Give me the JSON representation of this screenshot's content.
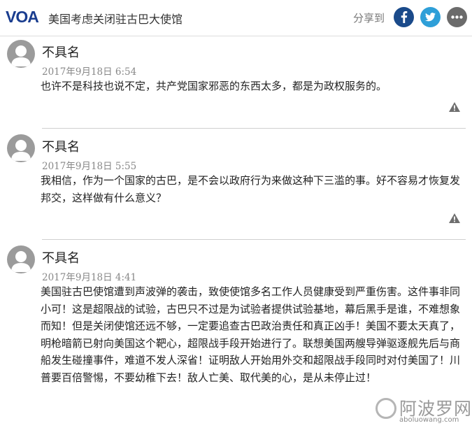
{
  "header": {
    "logo_text": "VOA",
    "title": "美国考虑关闭驻古巴大使馆",
    "share_label": "分享到",
    "social": [
      {
        "name": "facebook-share",
        "glyph": "f",
        "color": "#1a4a8a"
      },
      {
        "name": "twitter-share",
        "glyph": "bird",
        "color": "#2e9fd8"
      },
      {
        "name": "more-share",
        "glyph": "•••",
        "color": "#6b6b6b"
      }
    ]
  },
  "comments": [
    {
      "author": "不具名",
      "date": "2017年9月18日  6:54",
      "text": "也许不是科技也说不定，共产党国家邪恶的东西太多，都是为政权服务的。"
    },
    {
      "author": "不具名",
      "date": "2017年9月18日  5:55",
      "text": "我相信，作为一个国家的古巴，是不会以政府行为来做这种下三滥的事。好不容易才恢复发邦交，这样做有什么意义？"
    },
    {
      "author": "不具名",
      "date": "2017年9月18日  4:41",
      "text": "美国驻古巴使馆遭到声波弹的袭击，致使使馆多名工作人员健康受到严重伤害。这件事非同小可！这是超限战的试验，古巴只不过是为试验者提供试验基地，幕后黑手是谁，不难想象而知！但是关闭使馆还远不够，一定要追查古巴政治责任和真正凶手！美国不要太天真了，明枪暗箭已射向美国这个靶心，超限战手段开始进行了。联想美国两艘导弹驱逐舰先后与商船发生碰撞事件，难道不发人深省！证明敌人开始用外交和超限战手段同时对付美国了！川普要百倍警惕，不要幼稚下去！敌人亡美、取代美的心，是从未停止过！"
    }
  ],
  "watermark": {
    "main": "阿波罗网",
    "sub": "aboluowang.com"
  },
  "colors": {
    "voa_blue": "#1a3d8f",
    "avatar_gray": "#9b9b9b",
    "flag_gray": "#6e6e6e"
  }
}
